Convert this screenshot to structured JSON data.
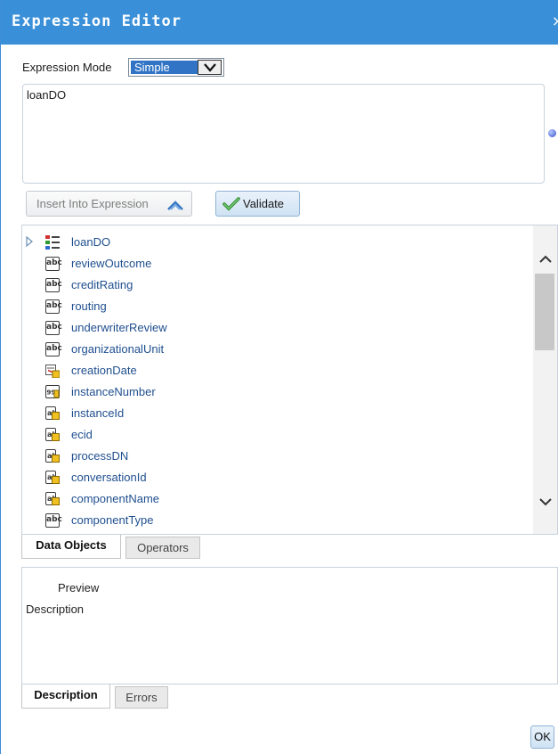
{
  "dialog": {
    "title": "Expression Editor",
    "close_glyph": "×"
  },
  "mode": {
    "label": "Expression Mode",
    "selected": "Simple"
  },
  "expression": {
    "value": "loanDO"
  },
  "buttons": {
    "insert": "Insert Into Expression",
    "validate": "Validate",
    "ok": "OK"
  },
  "tree": {
    "items": [
      {
        "label": "loanDO",
        "icon": "data-object-icon",
        "expandable": true
      },
      {
        "label": "reviewOutcome",
        "icon": "abc-string-icon"
      },
      {
        "label": "creditRating",
        "icon": "abc-string-icon"
      },
      {
        "label": "routing",
        "icon": "abc-string-icon"
      },
      {
        "label": "underwriterReview",
        "icon": "abc-string-icon"
      },
      {
        "label": "organizationalUnit",
        "icon": "abc-string-icon"
      },
      {
        "label": "creationDate",
        "icon": "calendar-icon"
      },
      {
        "label": "instanceNumber",
        "icon": "number-icon"
      },
      {
        "label": "instanceId",
        "icon": "readonly-string-icon"
      },
      {
        "label": "ecid",
        "icon": "readonly-string-icon"
      },
      {
        "label": "processDN",
        "icon": "readonly-string-icon"
      },
      {
        "label": "conversationId",
        "icon": "readonly-string-icon"
      },
      {
        "label": "componentName",
        "icon": "readonly-string-icon"
      },
      {
        "label": "componentType",
        "icon": "abc-string-icon"
      }
    ]
  },
  "tabs_top": [
    {
      "label": "Data Objects",
      "active": true
    },
    {
      "label": "Operators",
      "active": false
    }
  ],
  "preview": {
    "preview_label": "Preview",
    "description_label": "Description"
  },
  "tabs_bottom": [
    {
      "label": "Description",
      "active": true
    },
    {
      "label": "Errors",
      "active": false
    }
  ],
  "colors": {
    "titlebar": "#3a90d8",
    "tree_text": "#1f4f8f",
    "select_highlight": "#3174c6"
  }
}
